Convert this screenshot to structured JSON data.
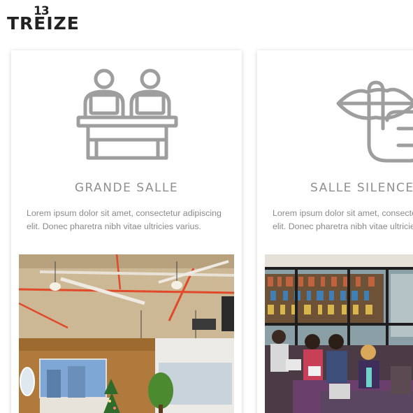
{
  "logo": {
    "number": "13",
    "word": "TREIZE"
  },
  "cards": [
    {
      "title": "GRANDE SALLE",
      "description": "Lorem ipsum dolor sit amet, consectetur adipiscing elit. Donec pharetra nibh vitae ultricies varius.",
      "icon": "people-at-desk-icon",
      "photo": "open-space-office-photo"
    },
    {
      "title": "SALLE SILENCE",
      "description": "Lorem ipsum dolor sit amet, consectetur adipiscing elit. Donec pharetra nibh vitae ultricies varius.",
      "icon": "silence-finger-on-lips-icon",
      "photo": "library-study-room-photo"
    }
  ],
  "colors": {
    "icon_gray": "#9e9e9e",
    "title_gray": "#8f8f8f",
    "text_gray": "#8a8a8a",
    "logo_dark": "#222222"
  }
}
